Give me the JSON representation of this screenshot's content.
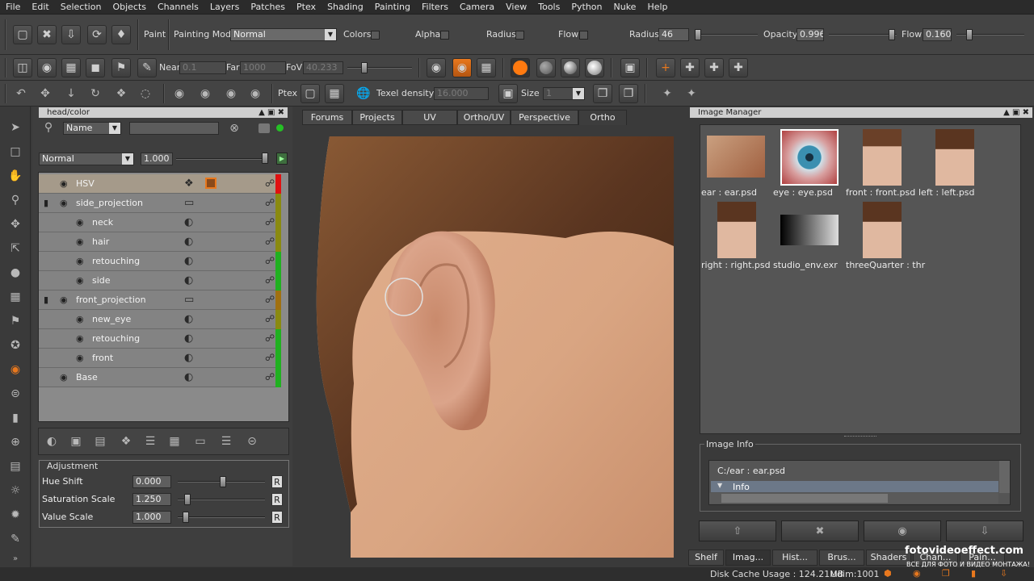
{
  "menu": [
    "File",
    "Edit",
    "Selection",
    "Objects",
    "Channels",
    "Layers",
    "Patches",
    "Ptex",
    "Shading",
    "Painting",
    "Filters",
    "Camera",
    "View",
    "Tools",
    "Python",
    "Nuke",
    "Help"
  ],
  "toolbar1": {
    "paint_label": "Paint",
    "painting_mode_label": "Painting Mode",
    "painting_mode_value": "Normal",
    "colors_label": "Colors",
    "alpha_label": "Alpha",
    "radius_chk_label": "Radius",
    "flow_chk_label": "Flow",
    "radius_label": "Radius",
    "radius_value": "46",
    "opacity_label": "Opacity",
    "opacity_value": "0.996",
    "flow_label": "Flow",
    "flow_value": "0.160"
  },
  "toolbar2": {
    "near_label": "Near",
    "near_value": "0.1",
    "far_label": "Far",
    "far_value": "1000",
    "fov_label": "FoV",
    "fov_value": "40.233"
  },
  "toolbar3": {
    "ptex_label": "Ptex",
    "texel_label": "Texel density :",
    "texel_value": "16.000",
    "size_label": "Size :",
    "size_value": "1"
  },
  "left_panel": {
    "title": "head/color",
    "search_mode": "Name",
    "blend_mode": "Normal",
    "layer_opacity": "1.000",
    "layers": [
      {
        "name": "HSV",
        "bar": "#e01010"
      },
      {
        "name": "side_projection",
        "bar": "#8a8a10"
      },
      {
        "name": "neck",
        "bar": "#8a8a10"
      },
      {
        "name": "hair",
        "bar": "#8a8a10"
      },
      {
        "name": "retouching",
        "bar": "#20b020"
      },
      {
        "name": "side",
        "bar": "#20b020"
      },
      {
        "name": "front_projection",
        "bar": "#a07010"
      },
      {
        "name": "new_eye",
        "bar": "#8a8a10"
      },
      {
        "name": "retouching",
        "bar": "#20b020"
      },
      {
        "name": "front",
        "bar": "#20b020"
      },
      {
        "name": "Base",
        "bar": "#20b020"
      }
    ],
    "adjustment_title": "Adjustment",
    "adjustments": [
      {
        "label": "Hue Shift",
        "value": "0.000",
        "level": 0.5
      },
      {
        "label": "Saturation Scale",
        "value": "1.250",
        "level": 0.12
      },
      {
        "label": "Value Scale",
        "value": "1.000",
        "level": 0.1
      }
    ],
    "reset_label": "R"
  },
  "view_tabs": [
    "Forums",
    "Projects",
    "UV",
    "Ortho/UV",
    "Perspective",
    "Ortho"
  ],
  "active_view_tab": "Ortho",
  "image_manager": {
    "title": "Image Manager",
    "images": [
      {
        "caption": "ear : ear.psd"
      },
      {
        "caption": "eye : eye.psd"
      },
      {
        "caption": "front : front.psd"
      },
      {
        "caption": "left : left.psd"
      },
      {
        "caption": "right : right.psd"
      },
      {
        "caption": "studio_env.exr"
      },
      {
        "caption": "threeQuarter : thr"
      }
    ],
    "info_title": "Image Info",
    "info_path": "C:/ear : ear.psd",
    "info_row": "Info"
  },
  "bottom_tabs": [
    "Shelf",
    "Imag...",
    "Hist...",
    "Brus...",
    "Shaders",
    "Chan...",
    "Pain..."
  ],
  "status": {
    "disk_cache": "Disk Cache Usage : 124.21MB",
    "udim": "Udim:1001"
  },
  "watermark": {
    "line1": "fotovideoeffect.com",
    "line2": "ВСЕ ДЛЯ ФОТО И ВИДЕО МОНТАЖА!"
  },
  "colors": {
    "accent_orange": "#e8781e",
    "panel": "#3e3e3e",
    "layer_bg": "#838383"
  }
}
